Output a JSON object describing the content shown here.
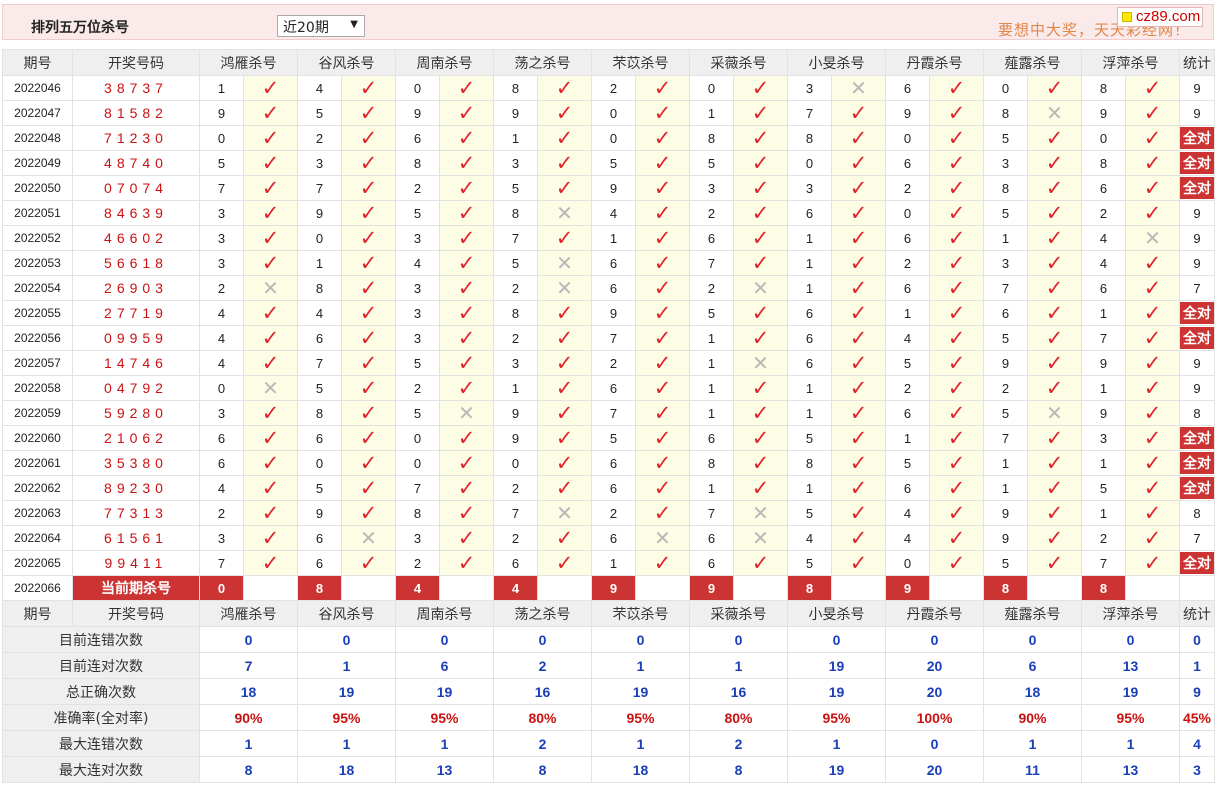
{
  "header": {
    "title": "排列五万位杀号",
    "select_value": "近20期",
    "slogan": "要想中大奖，天天彩经网！",
    "logo_text": "cz89.com"
  },
  "columns": {
    "period": "期号",
    "numbers": "开奖号码",
    "experts": [
      "鸿雁杀号",
      "谷风杀号",
      "周南杀号",
      "荡之杀号",
      "芣苡杀号",
      "采薇杀号",
      "小旻杀号",
      "丹霞杀号",
      "薤露杀号",
      "浮萍杀号"
    ],
    "stat": "统计"
  },
  "rows": [
    {
      "period": "2022046",
      "numbers": "38737",
      "kills": [
        "1",
        "4",
        "0",
        "8",
        "2",
        "0",
        "3",
        "6",
        "0",
        "8"
      ],
      "results": [
        1,
        1,
        1,
        1,
        1,
        1,
        0,
        1,
        1,
        1
      ],
      "stat": "9"
    },
    {
      "period": "2022047",
      "numbers": "81582",
      "kills": [
        "9",
        "5",
        "9",
        "9",
        "0",
        "1",
        "7",
        "9",
        "8",
        "9"
      ],
      "results": [
        1,
        1,
        1,
        1,
        1,
        1,
        1,
        1,
        0,
        1
      ],
      "stat": "9"
    },
    {
      "period": "2022048",
      "numbers": "71230",
      "kills": [
        "0",
        "2",
        "6",
        "1",
        "0",
        "8",
        "8",
        "0",
        "5",
        "0"
      ],
      "results": [
        1,
        1,
        1,
        1,
        1,
        1,
        1,
        1,
        1,
        1
      ],
      "stat": "全对"
    },
    {
      "period": "2022049",
      "numbers": "48740",
      "kills": [
        "5",
        "3",
        "8",
        "3",
        "5",
        "5",
        "0",
        "6",
        "3",
        "8"
      ],
      "results": [
        1,
        1,
        1,
        1,
        1,
        1,
        1,
        1,
        1,
        1
      ],
      "stat": "全对"
    },
    {
      "period": "2022050",
      "numbers": "07074",
      "kills": [
        "7",
        "7",
        "2",
        "5",
        "9",
        "3",
        "3",
        "2",
        "8",
        "6"
      ],
      "results": [
        1,
        1,
        1,
        1,
        1,
        1,
        1,
        1,
        1,
        1
      ],
      "stat": "全对"
    },
    {
      "period": "2022051",
      "numbers": "84639",
      "kills": [
        "3",
        "9",
        "5",
        "8",
        "4",
        "2",
        "6",
        "0",
        "5",
        "2"
      ],
      "results": [
        1,
        1,
        1,
        0,
        1,
        1,
        1,
        1,
        1,
        1
      ],
      "stat": "9"
    },
    {
      "period": "2022052",
      "numbers": "46602",
      "kills": [
        "3",
        "0",
        "3",
        "7",
        "1",
        "6",
        "1",
        "6",
        "1",
        "4"
      ],
      "results": [
        1,
        1,
        1,
        1,
        1,
        1,
        1,
        1,
        1,
        0
      ],
      "stat": "9"
    },
    {
      "period": "2022053",
      "numbers": "56618",
      "kills": [
        "3",
        "1",
        "4",
        "5",
        "6",
        "7",
        "1",
        "2",
        "3",
        "4"
      ],
      "results": [
        1,
        1,
        1,
        0,
        1,
        1,
        1,
        1,
        1,
        1
      ],
      "stat": "9"
    },
    {
      "period": "2022054",
      "numbers": "26903",
      "kills": [
        "2",
        "8",
        "3",
        "2",
        "6",
        "2",
        "1",
        "6",
        "7",
        "6"
      ],
      "results": [
        0,
        1,
        1,
        0,
        1,
        0,
        1,
        1,
        1,
        1
      ],
      "stat": "7"
    },
    {
      "period": "2022055",
      "numbers": "27719",
      "kills": [
        "4",
        "4",
        "3",
        "8",
        "9",
        "5",
        "6",
        "1",
        "6",
        "1"
      ],
      "results": [
        1,
        1,
        1,
        1,
        1,
        1,
        1,
        1,
        1,
        1
      ],
      "stat": "全对"
    },
    {
      "period": "2022056",
      "numbers": "09959",
      "kills": [
        "4",
        "6",
        "3",
        "2",
        "7",
        "1",
        "6",
        "4",
        "5",
        "7"
      ],
      "results": [
        1,
        1,
        1,
        1,
        1,
        1,
        1,
        1,
        1,
        1
      ],
      "stat": "全对"
    },
    {
      "period": "2022057",
      "numbers": "14746",
      "kills": [
        "4",
        "7",
        "5",
        "3",
        "2",
        "1",
        "6",
        "5",
        "9",
        "9"
      ],
      "results": [
        1,
        1,
        1,
        1,
        1,
        0,
        1,
        1,
        1,
        1
      ],
      "stat": "9"
    },
    {
      "period": "2022058",
      "numbers": "04792",
      "kills": [
        "0",
        "5",
        "2",
        "1",
        "6",
        "1",
        "1",
        "2",
        "2",
        "1"
      ],
      "results": [
        0,
        1,
        1,
        1,
        1,
        1,
        1,
        1,
        1,
        1
      ],
      "stat": "9"
    },
    {
      "period": "2022059",
      "numbers": "59280",
      "kills": [
        "3",
        "8",
        "5",
        "9",
        "7",
        "1",
        "1",
        "6",
        "5",
        "9"
      ],
      "results": [
        1,
        1,
        0,
        1,
        1,
        1,
        1,
        1,
        0,
        1
      ],
      "stat": "8"
    },
    {
      "period": "2022060",
      "numbers": "21062",
      "kills": [
        "6",
        "6",
        "0",
        "9",
        "5",
        "6",
        "5",
        "1",
        "7",
        "3"
      ],
      "results": [
        1,
        1,
        1,
        1,
        1,
        1,
        1,
        1,
        1,
        1
      ],
      "stat": "全对"
    },
    {
      "period": "2022061",
      "numbers": "35380",
      "kills": [
        "6",
        "0",
        "0",
        "0",
        "6",
        "8",
        "8",
        "5",
        "1",
        "1"
      ],
      "results": [
        1,
        1,
        1,
        1,
        1,
        1,
        1,
        1,
        1,
        1
      ],
      "stat": "全对"
    },
    {
      "period": "2022062",
      "numbers": "89230",
      "kills": [
        "4",
        "5",
        "7",
        "2",
        "6",
        "1",
        "1",
        "6",
        "1",
        "5"
      ],
      "results": [
        1,
        1,
        1,
        1,
        1,
        1,
        1,
        1,
        1,
        1
      ],
      "stat": "全对"
    },
    {
      "period": "2022063",
      "numbers": "77313",
      "kills": [
        "2",
        "9",
        "8",
        "7",
        "2",
        "7",
        "5",
        "4",
        "9",
        "1"
      ],
      "results": [
        1,
        1,
        1,
        0,
        1,
        0,
        1,
        1,
        1,
        1
      ],
      "stat": "8"
    },
    {
      "period": "2022064",
      "numbers": "61561",
      "kills": [
        "3",
        "6",
        "3",
        "2",
        "6",
        "6",
        "4",
        "4",
        "9",
        "2"
      ],
      "results": [
        1,
        0,
        1,
        1,
        0,
        0,
        1,
        1,
        1,
        1
      ],
      "stat": "7"
    },
    {
      "period": "2022065",
      "numbers": "99411",
      "kills": [
        "7",
        "6",
        "2",
        "6",
        "1",
        "6",
        "5",
        "0",
        "5",
        "7"
      ],
      "results": [
        1,
        1,
        1,
        1,
        1,
        1,
        1,
        1,
        1,
        1
      ],
      "stat": "全对"
    }
  ],
  "current": {
    "period": "2022066",
    "label": "当前期杀号",
    "kills": [
      "0",
      "8",
      "4",
      "4",
      "9",
      "9",
      "8",
      "9",
      "8",
      "8"
    ]
  },
  "summary": [
    {
      "label": "目前连错次数",
      "values": [
        "0",
        "0",
        "0",
        "0",
        "0",
        "0",
        "0",
        "0",
        "0",
        "0"
      ],
      "stat": "0"
    },
    {
      "label": "目前连对次数",
      "values": [
        "7",
        "1",
        "6",
        "2",
        "1",
        "1",
        "19",
        "20",
        "6",
        "13"
      ],
      "stat": "1"
    },
    {
      "label": "总正确次数",
      "values": [
        "18",
        "19",
        "19",
        "16",
        "19",
        "16",
        "19",
        "20",
        "18",
        "19"
      ],
      "stat": "9"
    },
    {
      "label": "准确率(全对率)",
      "values": [
        "90%",
        "95%",
        "95%",
        "80%",
        "95%",
        "80%",
        "95%",
        "100%",
        "90%",
        "95%"
      ],
      "stat": "45%",
      "rate": true
    },
    {
      "label": "最大连错次数",
      "values": [
        "1",
        "1",
        "1",
        "2",
        "1",
        "2",
        "1",
        "0",
        "1",
        "1"
      ],
      "stat": "4"
    },
    {
      "label": "最大连对次数",
      "values": [
        "8",
        "18",
        "13",
        "8",
        "18",
        "8",
        "19",
        "20",
        "11",
        "13"
      ],
      "stat": "3"
    }
  ],
  "icons": {
    "correct": "check-icon",
    "wrong": "cross-icon"
  },
  "colors": {
    "accent_red": "#cc3333",
    "number_red": "#cc1111",
    "summary_blue": "#1a3fb8",
    "slogan_orange": "#e0874a"
  }
}
